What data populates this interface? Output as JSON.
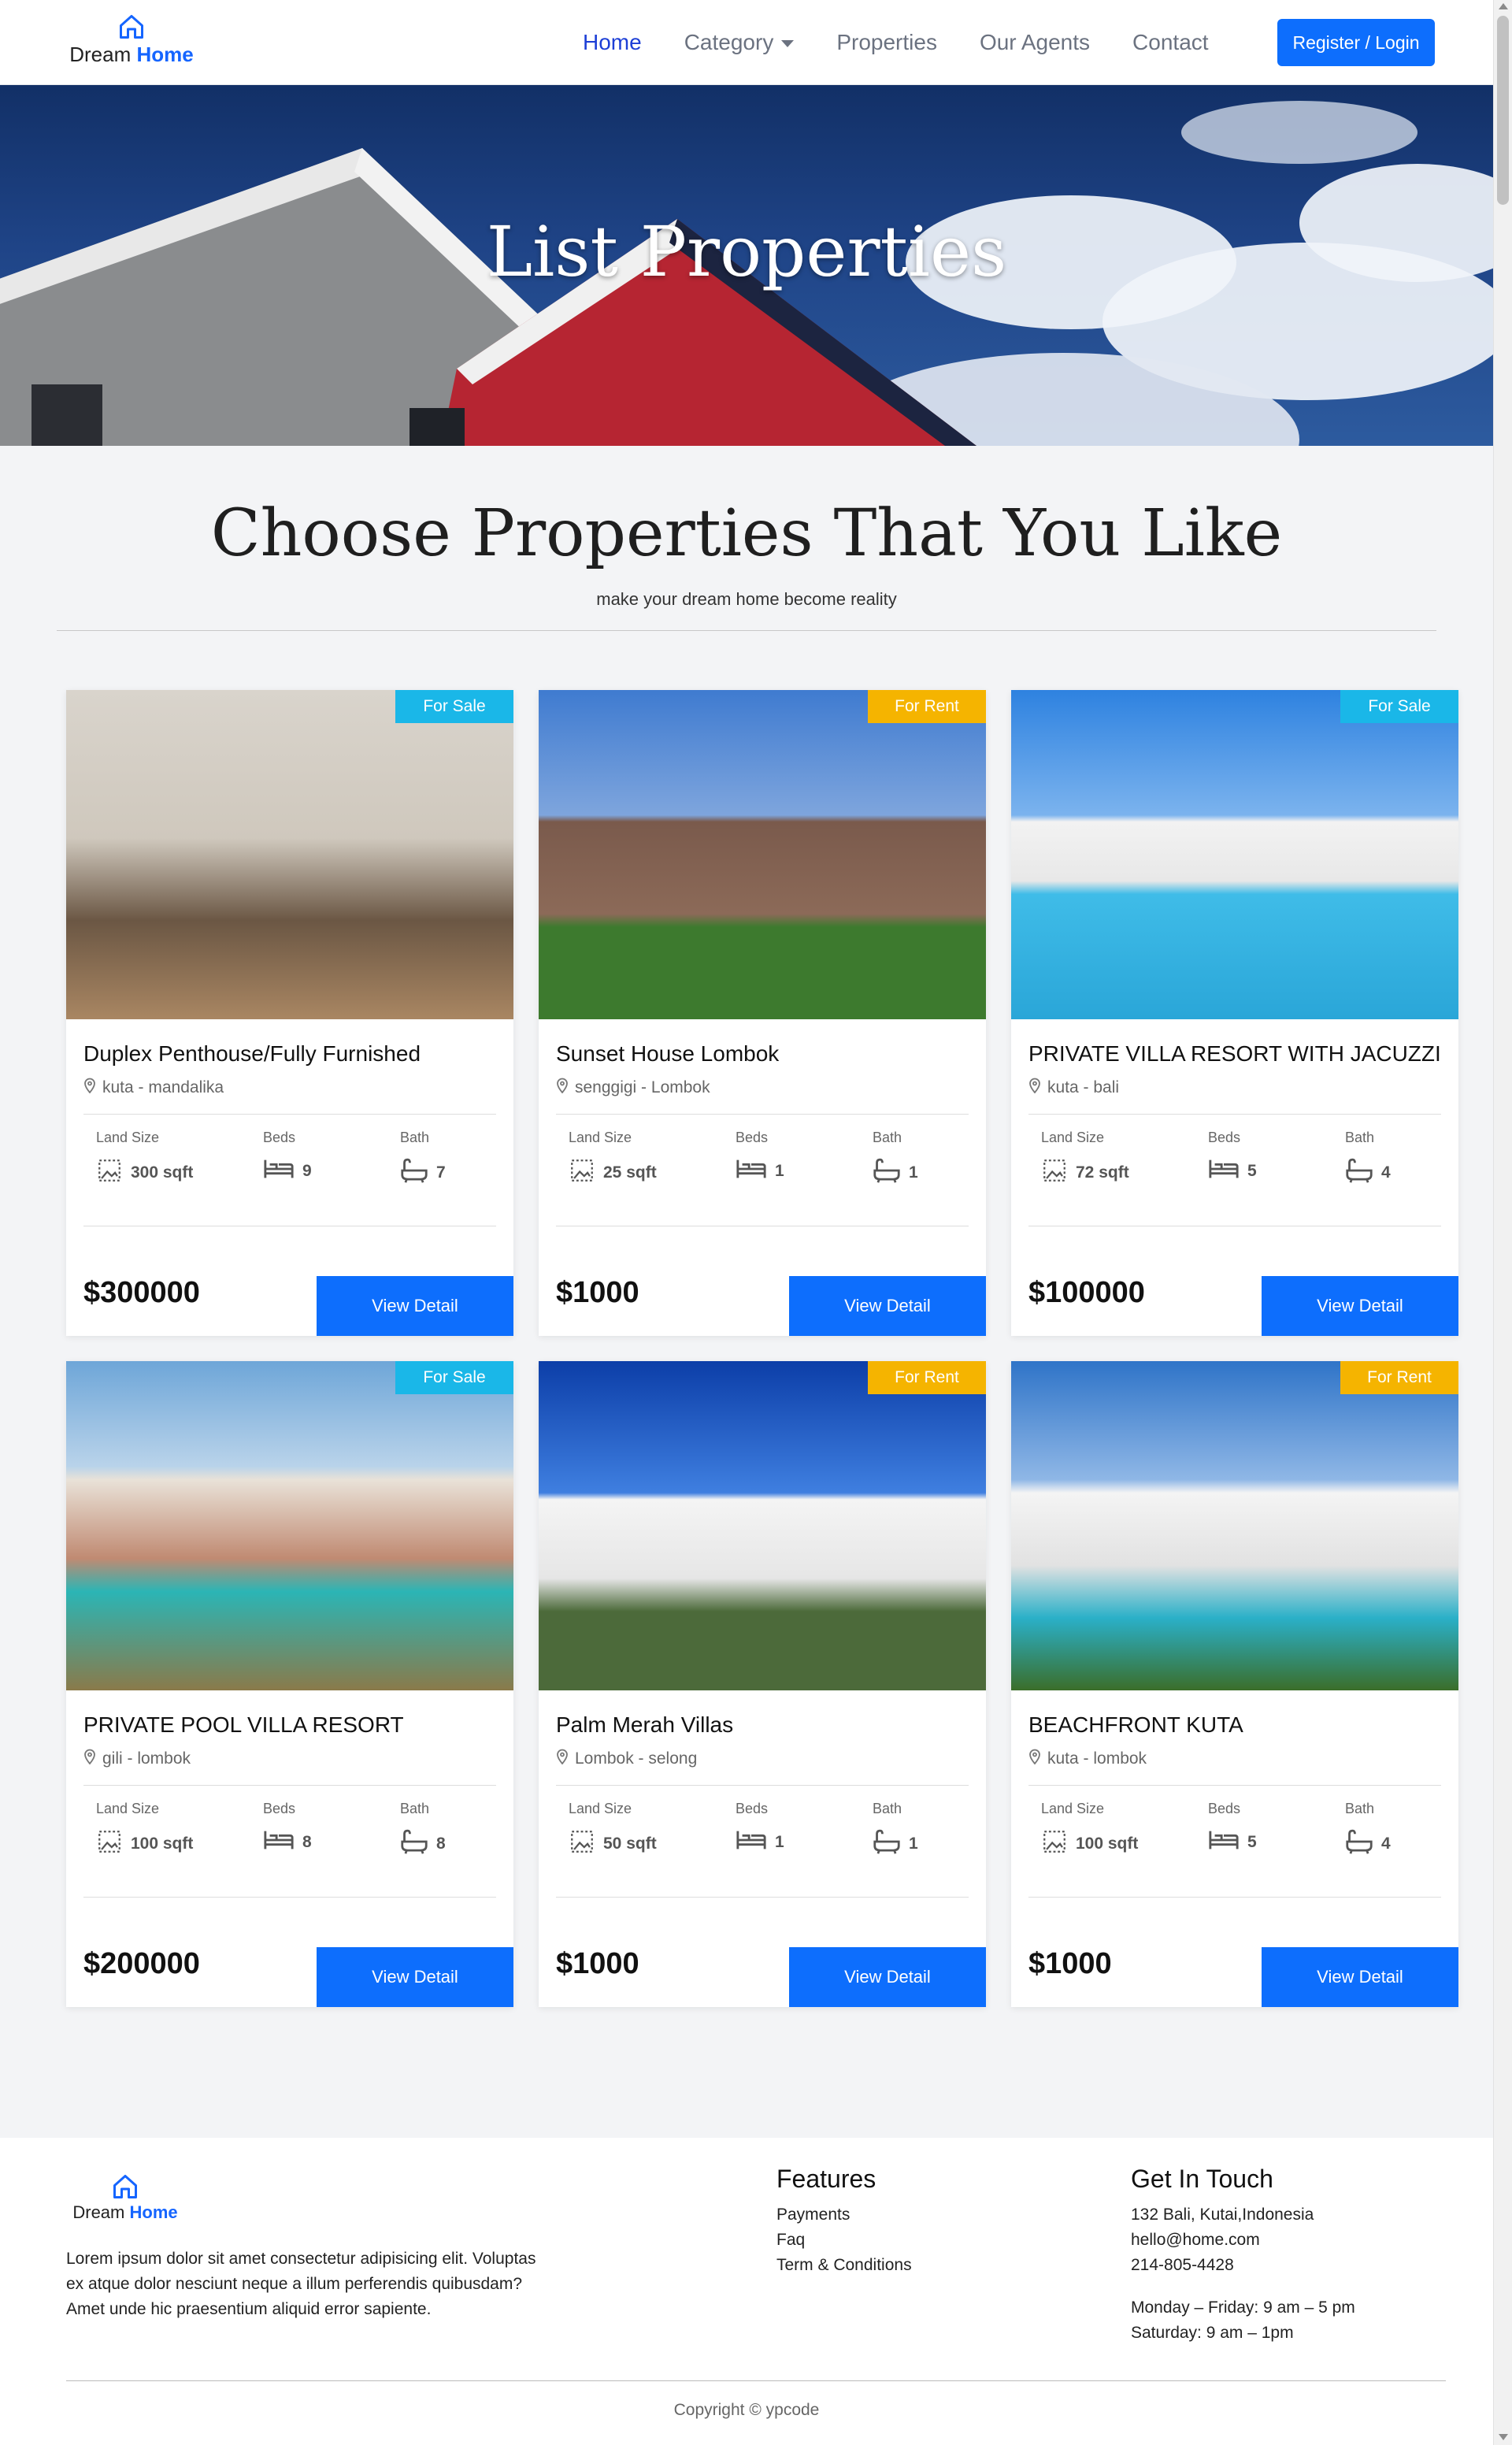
{
  "nav": {
    "brand_part1": "Dream",
    "brand_part2": "Home",
    "links": [
      "Home",
      "Category",
      "Properties",
      "Our Agents",
      "Contact"
    ],
    "active": "Home",
    "login_label": "Register / Login"
  },
  "hero": {
    "title": "List Properties"
  },
  "section": {
    "title": "Choose Properties That You Like",
    "subtitle": "make your dream home become reality"
  },
  "labels": {
    "land_size": "Land Size",
    "beds": "Beds",
    "bath": "Bath",
    "view_detail": "View Detail"
  },
  "colors": {
    "primary": "#0d6efd",
    "badge_sale": "#1ab7e8",
    "badge_rent": "#f5b400",
    "hero_sky": "#1f4487"
  },
  "properties": [
    {
      "title": "Duplex Penthouse/Fully Furnished",
      "location": "kuta - mandalika",
      "status": "For Sale",
      "land_size": "300 sqft",
      "beds": "9",
      "bath": "7",
      "price": "$300000"
    },
    {
      "title": "Sunset House Lombok",
      "location": "senggigi - Lombok",
      "status": "For Rent",
      "land_size": "25 sqft",
      "beds": "1",
      "bath": "1",
      "price": "$1000"
    },
    {
      "title": "PRIVATE VILLA RESORT WITH JACUZZI",
      "location": "kuta - bali",
      "status": "For Sale",
      "land_size": "72 sqft",
      "beds": "5",
      "bath": "4",
      "price": "$100000"
    },
    {
      "title": "PRIVATE POOL VILLA RESORT",
      "location": "gili - lombok",
      "status": "For Sale",
      "land_size": "100 sqft",
      "beds": "8",
      "bath": "8",
      "price": "$200000"
    },
    {
      "title": "Palm Merah Villas",
      "location": "Lombok - selong",
      "status": "For Rent",
      "land_size": "50 sqft",
      "beds": "1",
      "bath": "1",
      "price": "$1000"
    },
    {
      "title": "BEACHFRONT KUTA",
      "location": "kuta - lombok",
      "status": "For Rent",
      "land_size": "100 sqft",
      "beds": "5",
      "bath": "4",
      "price": "$1000"
    }
  ],
  "footer": {
    "brand_part1": "Dream",
    "brand_part2": "Home",
    "about": "Lorem ipsum dolor sit amet consectetur adipisicing elit. Voluptas ex atque dolor nesciunt neque a illum perferendis quibusdam? Amet unde hic praesentium aliquid error sapiente.",
    "features_title": "Features",
    "features": [
      "Payments",
      "Faq",
      "Term & Conditions"
    ],
    "contact_title": "Get In Touch",
    "address": "132 Bali, Kutai,Indonesia",
    "email": "hello@home.com",
    "phone": "214-805-4428",
    "hours_weekday": "Monday – Friday: 9 am – 5 pm",
    "hours_saturday": "Saturday: 9 am – 1pm",
    "copyright": "Copyright © ypcode"
  }
}
